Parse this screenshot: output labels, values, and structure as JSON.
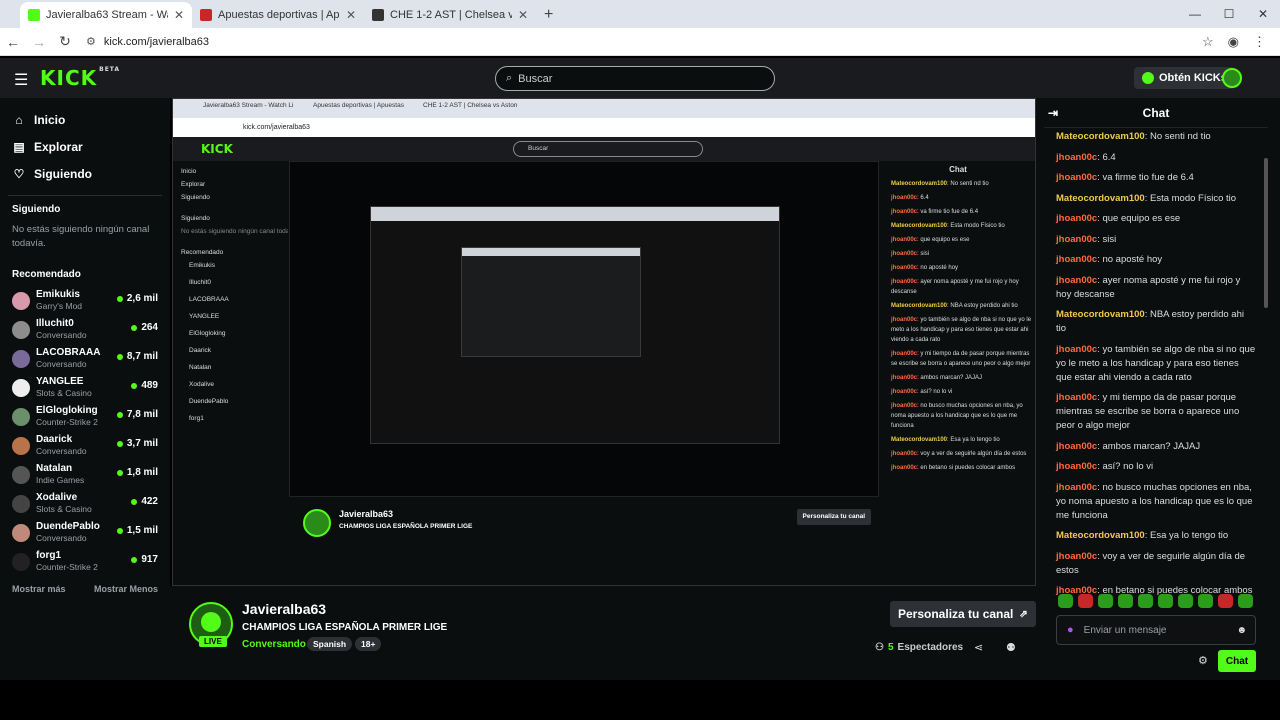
{
  "browser": {
    "tabs": [
      {
        "title": "Javieralba63 Stream - Watch Li",
        "color": "#53fc18"
      },
      {
        "title": "Apuestas deportivas | Apuestas",
        "color": "#c62828"
      },
      {
        "title": "CHE 1-2 AST | Chelsea vs Aston",
        "color": "#333333"
      }
    ],
    "url": "kick.com/javieralba63"
  },
  "header": {
    "logo": "KICK",
    "logo_sup": "BETA",
    "search_placeholder": "Buscar",
    "kicks_button": "Obtén KICKs"
  },
  "sidebar": {
    "nav": [
      {
        "label": "Inicio",
        "icon": "home-icon"
      },
      {
        "label": "Explorar",
        "icon": "compass-icon"
      },
      {
        "label": "Siguiendo",
        "icon": "heart-icon"
      }
    ],
    "following_title": "Siguiendo",
    "following_note": "No estás siguiendo ningún canal todavía.",
    "recommended_title": "Recomendado",
    "recommended": [
      {
        "name": "Emikukis",
        "category": "Garry's Mod",
        "viewers": "2,6 mil",
        "color": "#d89aa8"
      },
      {
        "name": "Illuchit0",
        "category": "Conversando",
        "viewers": "264",
        "color": "#8d8d8d"
      },
      {
        "name": "LACOBRAAA",
        "category": "Conversando",
        "viewers": "8,7 mil",
        "color": "#7a6a9a"
      },
      {
        "name": "YANGLEE",
        "category": "Slots & Casino",
        "viewers": "489",
        "color": "#eeeeee"
      },
      {
        "name": "ElGlogloking",
        "category": "Counter-Strike 2",
        "viewers": "7,8 mil",
        "color": "#6b8e6b"
      },
      {
        "name": "Daarick",
        "category": "Conversando",
        "viewers": "3,7 mil",
        "color": "#b8734a"
      },
      {
        "name": "Natalan",
        "category": "Indie Games",
        "viewers": "1,8 mil",
        "color": "#555555"
      },
      {
        "name": "Xodalive",
        "category": "Slots & Casino",
        "viewers": "422",
        "color": "#444444"
      },
      {
        "name": "DuendePablo",
        "category": "Conversando",
        "viewers": "1,5 mil",
        "color": "#c08a7a"
      },
      {
        "name": "forg1",
        "category": "Counter-Strike 2",
        "viewers": "917",
        "color": "#222222"
      }
    ],
    "show_more": "Mostrar más",
    "show_less": "Mostrar Menos"
  },
  "stream": {
    "channel": "Javieralba63",
    "title": "CHAMPIOS LIGA ESPAÑOLA PRIMER LIGE",
    "category": "Conversando",
    "tags": [
      "Spanish",
      "18+"
    ],
    "live_badge": "LIVE",
    "personalize_button": "Personaliza tu canal",
    "viewers_count": "5",
    "viewers_label": "Espectadores"
  },
  "chat": {
    "title": "Chat",
    "messages": [
      {
        "user": "Mateocordovam100",
        "text": "No senti nd tio",
        "color": "#f2c94c"
      },
      {
        "user": "jhoan00c",
        "text": "6.4",
        "color": "#ff6a3d"
      },
      {
        "user": "jhoan00c",
        "text": "va firme tio fue de 6.4",
        "color": "#ff6a3d"
      },
      {
        "user": "Mateocordovam100",
        "text": "Esta modo Físico tio",
        "color": "#f2c94c"
      },
      {
        "user": "jhoan00c",
        "text": "que equipo es ese",
        "color": "#ff6a3d"
      },
      {
        "user": "jhoan00c",
        "text": "sisi",
        "color": "#ff6a3d"
      },
      {
        "user": "jhoan00c",
        "text": "no aposté hoy",
        "color": "#ff6a3d"
      },
      {
        "user": "jhoan00c",
        "text": "ayer noma aposté y me fui rojo y hoy descanse",
        "color": "#ff6a3d"
      },
      {
        "user": "Mateocordovam100",
        "text": "NBA estoy perdido ahi tio",
        "color": "#f2c94c"
      },
      {
        "user": "jhoan00c",
        "text": "yo también se algo de nba si no que yo le meto a los handicap y para eso tienes que estar ahi viendo a cada rato",
        "color": "#ff6a3d"
      },
      {
        "user": "jhoan00c",
        "text": "y mi tiempo da de pasar porque mientras se escribe se borra o aparece uno peor o algo mejor",
        "color": "#ff6a3d"
      },
      {
        "user": "jhoan00c",
        "text": "ambos marcan? JAJAJ",
        "color": "#ff6a3d"
      },
      {
        "user": "jhoan00c",
        "text": "así? no lo vi",
        "color": "#ff6a3d"
      },
      {
        "user": "jhoan00c",
        "text": "no busco muchas opciones en nba, yo noma apuesto a los handicap que es lo que me funciona",
        "color": "#ff6a3d"
      },
      {
        "user": "Mateocordovam100",
        "text": "Esa ya lo tengo tio",
        "color": "#f2c94c"
      },
      {
        "user": "jhoan00c",
        "text": "voy a ver de seguirle algún día de estos",
        "color": "#ff6a3d"
      },
      {
        "user": "jhoan00c",
        "text": "en betano si puedes colocar ambos",
        "color": "#ff6a3d"
      }
    ],
    "input_placeholder": "Enviar un mensaje",
    "send_button": "Chat"
  }
}
